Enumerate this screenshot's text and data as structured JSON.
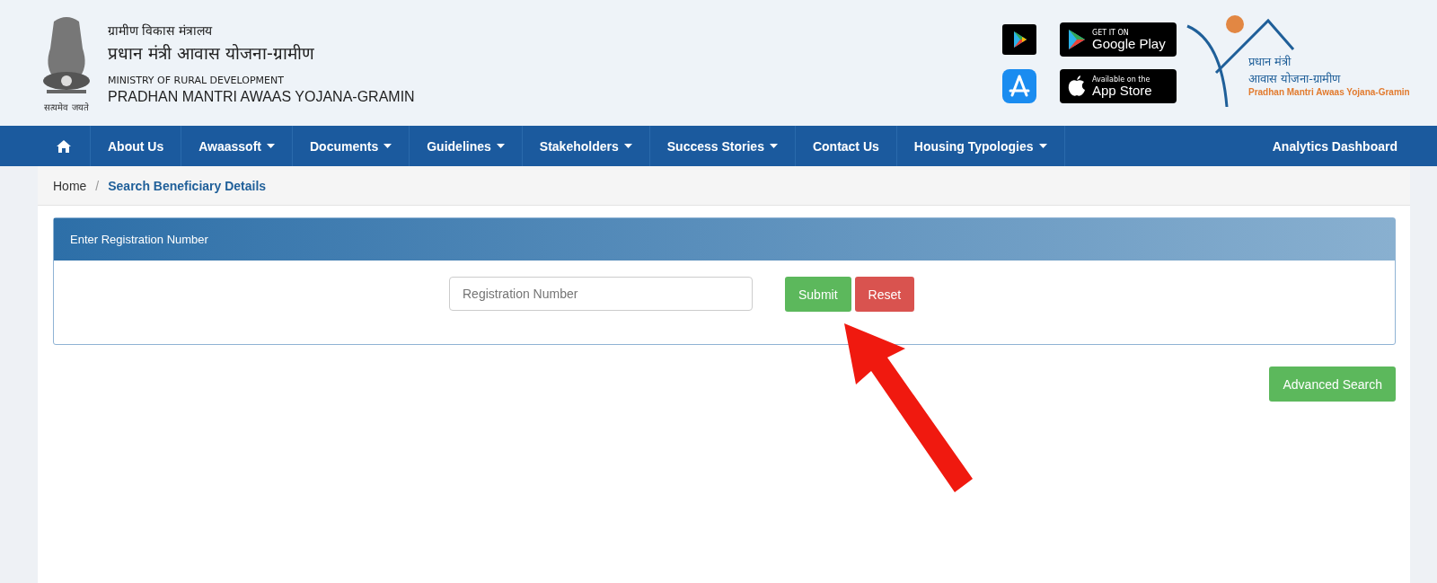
{
  "header": {
    "emblem_motto": "सत्यमेव जयते",
    "ministry_hindi": "ग्रामीण विकास मंत्रालय",
    "scheme_hindi": "प्रधान मंत्री आवास योजना-ग्रामीण",
    "ministry_english": "MINISTRY OF RURAL DEVELOPMENT",
    "scheme_english": "PRADHAN MANTRI AWAAS YOJANA-GRAMIN",
    "google_play": {
      "small": "GET IT ON",
      "big": "Google Play"
    },
    "app_store": {
      "small": "Available on the",
      "big": "App Store"
    },
    "logo": {
      "line_1": "प्रधान मंत्री",
      "line_2": "आवास योजना-ग्रामीण",
      "line_3": "Pradhan Mantri Awaas Yojana-Gramin"
    }
  },
  "nav": {
    "items": [
      {
        "label": "About Us",
        "dropdown": false
      },
      {
        "label": "Awaassoft",
        "dropdown": true
      },
      {
        "label": "Documents",
        "dropdown": true
      },
      {
        "label": "Guidelines",
        "dropdown": true
      },
      {
        "label": "Stakeholders",
        "dropdown": true
      },
      {
        "label": "Success Stories",
        "dropdown": true
      },
      {
        "label": "Contact Us",
        "dropdown": false
      },
      {
        "label": "Housing Typologies",
        "dropdown": true
      }
    ],
    "right": "Analytics Dashboard"
  },
  "breadcrumb": {
    "items": [
      "Home",
      "Search Beneficiary Details"
    ],
    "separator": "/"
  },
  "panel": {
    "title": "Enter Registration Number",
    "field": {
      "placeholder": "Registration Number"
    },
    "buttons": [
      {
        "label": "Submit",
        "kind": "success"
      },
      {
        "label": "Reset",
        "kind": "danger"
      }
    ]
  },
  "advanced_search": "Advanced Search"
}
